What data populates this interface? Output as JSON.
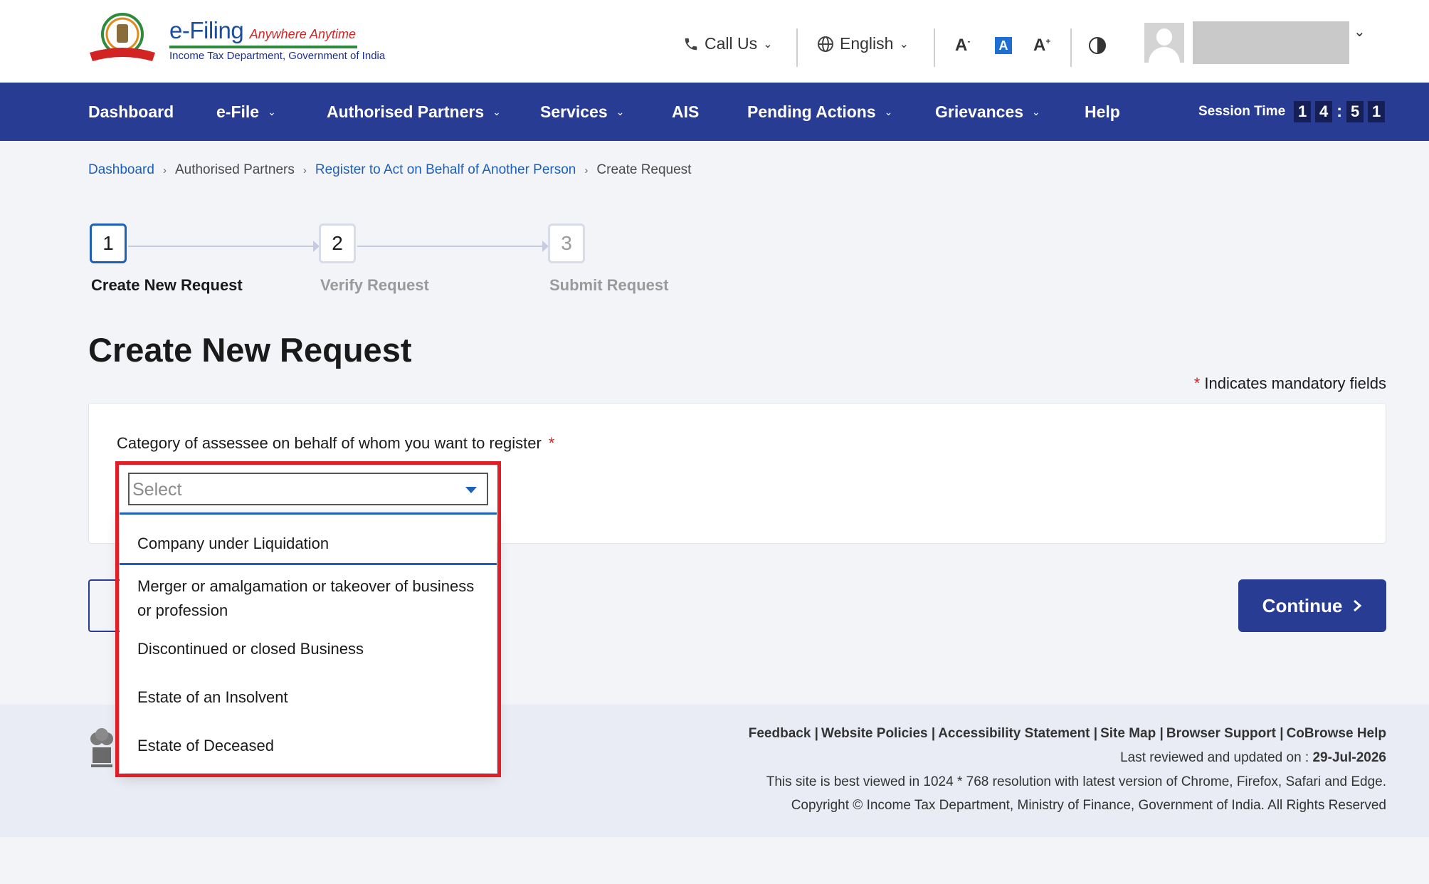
{
  "header": {
    "brand_main": "e-Filing",
    "brand_tagline": "Anywhere Anytime",
    "brand_sub": "Income Tax Department, Government of India",
    "call_us": "Call Us",
    "language": "English",
    "font_decrease": "A",
    "font_normal": "A",
    "font_increase": "A"
  },
  "nav": {
    "items": [
      {
        "label": "Dashboard"
      },
      {
        "label": "e-File"
      },
      {
        "label": "Authorised Partners"
      },
      {
        "label": "Services"
      },
      {
        "label": "AIS"
      },
      {
        "label": "Pending Actions"
      },
      {
        "label": "Grievances"
      },
      {
        "label": "Help"
      }
    ],
    "session_label": "Session Time",
    "session_digits": [
      "1",
      "4",
      "5",
      "1"
    ]
  },
  "breadcrumb": [
    "Dashboard",
    "Authorised Partners",
    "Register to Act on Behalf of Another Person",
    "Create Request"
  ],
  "stepper": [
    {
      "number": "1",
      "label": "Create New Request",
      "state": "active"
    },
    {
      "number": "2",
      "label": "Verify Request",
      "state": "pending"
    },
    {
      "number": "3",
      "label": "Submit Request",
      "state": "disabled"
    }
  ],
  "page": {
    "title": "Create New Request",
    "mandatory_star": "*",
    "mandatory_note": "Indicates mandatory fields"
  },
  "form": {
    "category_label": "Category of assessee on behalf of whom you want to register",
    "required_star": "*",
    "select_placeholder": "Select",
    "options": [
      "Company under Liquidation",
      "Merger or amalgamation or takeover of business or profession",
      "Discontinued or closed Business",
      "Estate of an Insolvent",
      "Estate of Deceased"
    ]
  },
  "actions": {
    "continue_label": "Continue"
  },
  "footer": {
    "links": [
      "Feedback |",
      "Website Policies |",
      "Accessibility Statement |",
      "Site Map |",
      "Browser Support |",
      "CoBrowse Help"
    ],
    "last_reviewed_label": "Last reviewed and updated on :",
    "last_reviewed_date": "29-Jul-2026",
    "resolution_note": "This site is best viewed in 1024 * 768 resolution with latest version of Chrome, Firefox, Safari and Edge.",
    "copyright": "Copyright © Income Tax Department, Ministry of Finance, Government of India. All Rights Reserved"
  },
  "colors": {
    "nav_bg": "#283c94",
    "link": "#1e5fb9",
    "highlight": "#e11d25",
    "required": "#d32424"
  }
}
